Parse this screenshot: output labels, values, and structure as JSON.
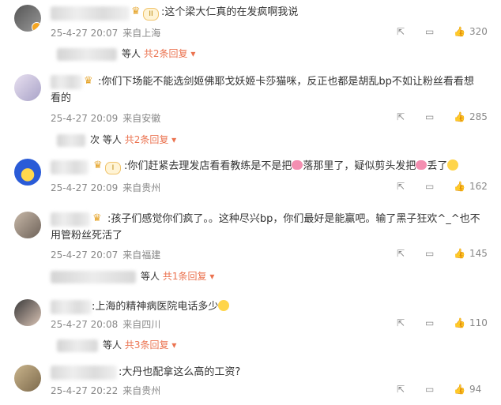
{
  "comments": [
    {
      "text": ":这个梁大仁真的在发疯啊我说",
      "date": "25-4-27 20:07",
      "location": "来自上海",
      "likes": "320",
      "reply_suffix": "等人",
      "reply_link": "共2条回复",
      "badge": "II"
    },
    {
      "text": ":你们下场能不能选剑姬佛耶戈妖姬卡莎猫咪，反正也都是胡乱bp不如让粉丝看看想",
      "text2": "看的",
      "date": "25-4-27 20:09",
      "location": "来自安徽",
      "likes": "285",
      "reply_suffix": "等人",
      "reply_link": "共2条回复",
      "reply_prefix": "次"
    },
    {
      "text_a": ":你们赶紧去理发店看看教练是不是把",
      "text_b": "落那里了，疑似剪头发把",
      "text_c": "丢了",
      "date": "25-4-27 20:09",
      "location": "来自贵州",
      "likes": "162",
      "badge": "I"
    },
    {
      "text": ":孩子们感觉你们疯了。。这种尽兴bp，你们最好是能赢吧。输了黑子狂欢^_^也不",
      "text2": "用管粉丝死活了",
      "date": "25-4-27 20:07",
      "location": "来自福建",
      "likes": "145",
      "reply_suffix": "等人",
      "reply_link": "共1条回复"
    },
    {
      "text": ":上海的精神病医院电话多少",
      "date": "25-4-27 20:08",
      "location": "来自四川",
      "likes": "110",
      "reply_suffix": "等人",
      "reply_link": "共3条回复"
    },
    {
      "text": ":大丹也配拿这么高的工资?",
      "date": "25-4-27 20:22",
      "location": "来自贵州",
      "likes": "94"
    }
  ],
  "icons": {
    "share": "share-icon",
    "comment": "comment-icon",
    "like": "thumbs-up-icon",
    "dropdown": "chevron-down-icon"
  },
  "colors": {
    "link": "#eb7350",
    "meta": "#888888"
  }
}
